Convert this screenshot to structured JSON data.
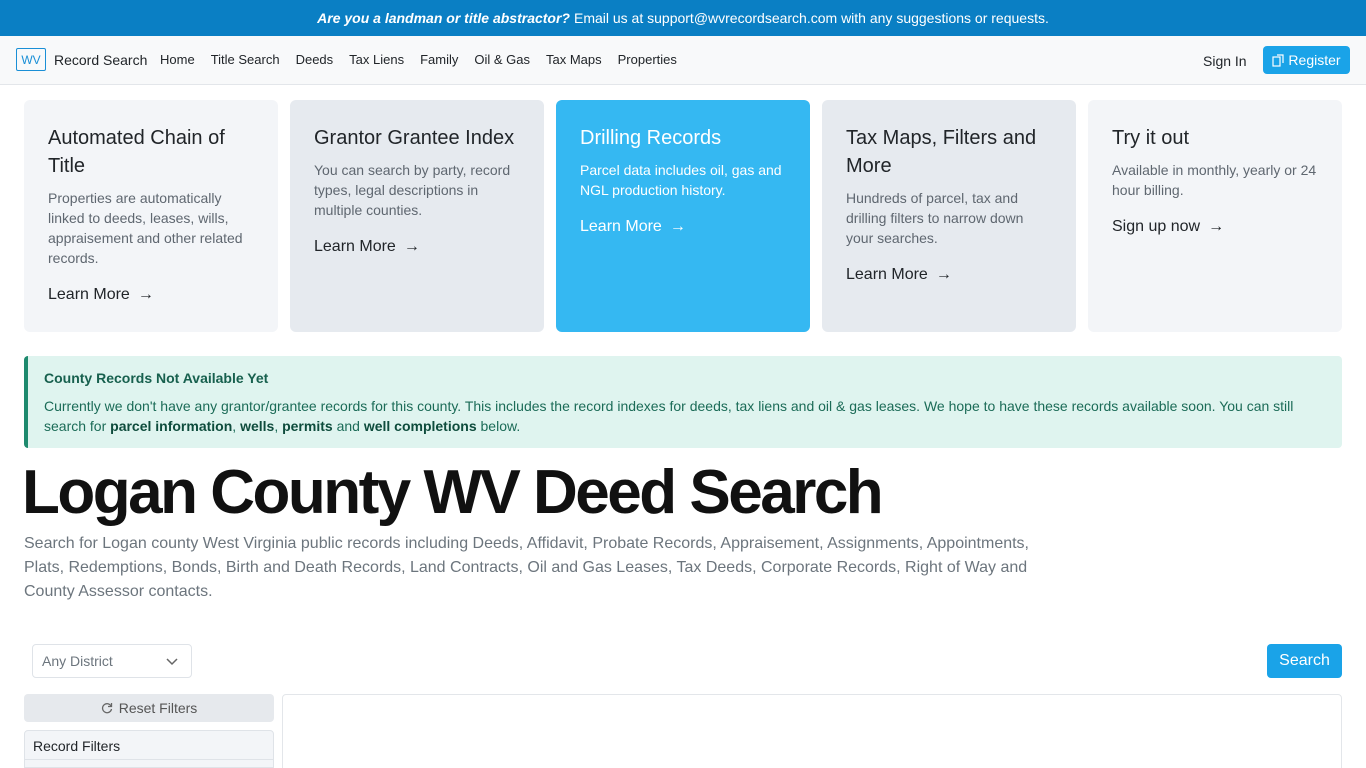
{
  "topbar": {
    "question": "Are you a landman or title abstractor?",
    "message": "Email us at support@wvrecordsearch.com with any suggestions or requests."
  },
  "nav": {
    "logo": "WV",
    "brand": "Record Search",
    "links": [
      "Home",
      "Title Search",
      "Deeds",
      "Tax Liens",
      "Family",
      "Oil & Gas",
      "Tax Maps",
      "Properties"
    ],
    "signin": "Sign In",
    "register": "Register"
  },
  "cards": [
    {
      "title": "Automated Chain of Title",
      "text": "Properties are automatically linked to deeds, leases, wills, appraisement and other related records.",
      "link": "Learn More"
    },
    {
      "title": "Grantor Grantee Index",
      "text": "You can search by party, record types, legal descriptions in multiple counties.",
      "link": "Learn More"
    },
    {
      "title": "Drilling Records",
      "text": "Parcel data includes oil, gas and NGL production history.",
      "link": "Learn More"
    },
    {
      "title": "Tax Maps, Filters and More",
      "text": "Hundreds of parcel, tax and drilling filters to narrow down your searches.",
      "link": "Learn More"
    },
    {
      "title": "Try it out",
      "text": "Available in monthly, yearly or 24 hour billing.",
      "link": "Sign up now"
    }
  ],
  "alert": {
    "title": "County Records Not Available Yet",
    "body_start": "Currently we don't have any grantor/grantee records for this county. This includes the record indexes for deeds, tax liens and oil & gas leases. We hope to have these records available soon. You can still search for",
    "link1": "parcel information",
    "sep1": ",",
    "link2": "wells",
    "sep2": ",",
    "link3": "permits",
    "and": "and",
    "link4": "well completions",
    "body_end": "below."
  },
  "heading": "Logan County WV Deed Search",
  "lead": "Search for Logan county West Virginia public records including Deeds, Affidavit, Probate Records, Appraisement, Assignments, Appointments, Plats, Redemptions, Bonds, Birth and Death Records, Land Contracts, Oil and Gas Leases, Tax Deeds, Corporate Records, Right of Way and County Assessor contacts.",
  "filters": {
    "district": "Any District",
    "search": "Search",
    "reset": "Reset Filters",
    "record_filters": "Record Filters"
  }
}
